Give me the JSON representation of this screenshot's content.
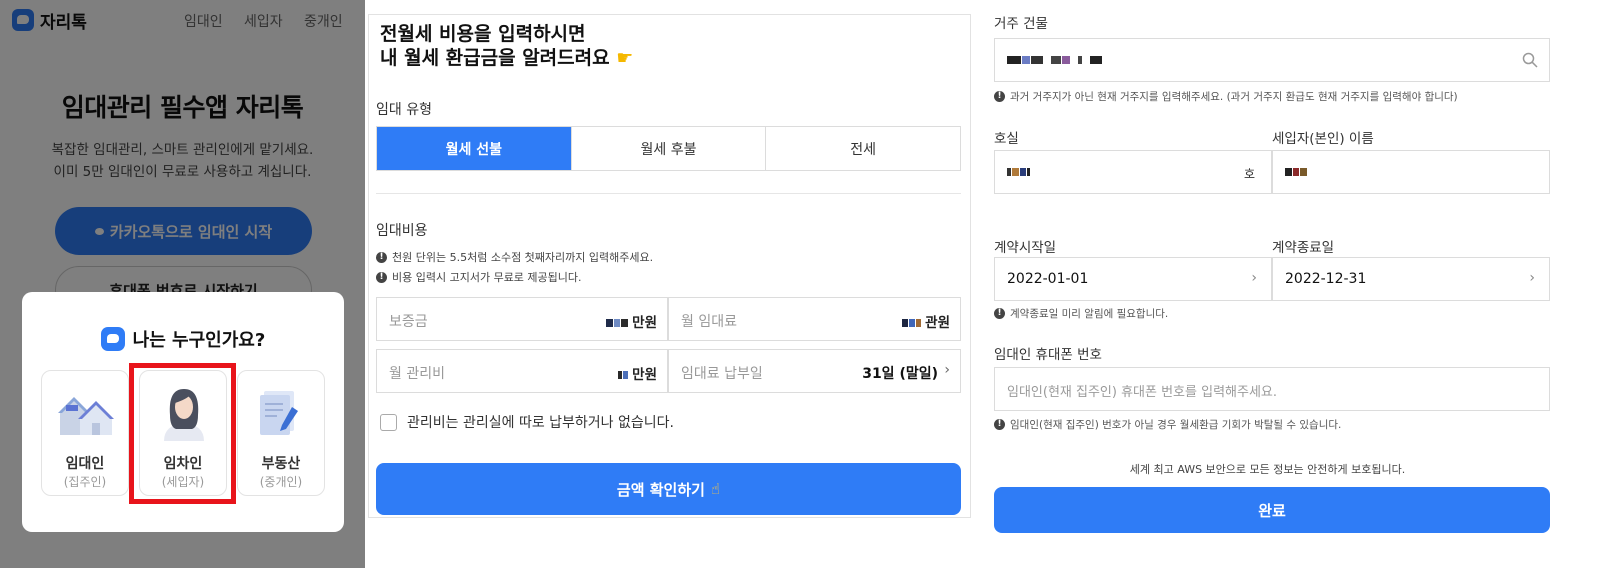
{
  "panel1": {
    "brand": "자리톡",
    "nav": [
      "임대인",
      "세입자",
      "중개인"
    ],
    "hero_title": "임대관리 필수앱 자리톡",
    "hero_sub1": "복잡한 임대관리, 스마트 관리인에게 맡기세요.",
    "hero_sub2": "이미 5만 임대인이 무료로 사용하고 계십니다.",
    "kakao_button": "카카오톡으로 임대인 시작",
    "phone_button": "휴대폰 번호로 시작하기",
    "sheet_title": "나는 누구인가요?",
    "roles": [
      {
        "name": "임대인",
        "sub": "(집주인)",
        "icon": "house-illustration"
      },
      {
        "name": "임차인",
        "sub": "(세입자)",
        "icon": "person-illustration",
        "selected": true
      },
      {
        "name": "부동산",
        "sub": "(중개인)",
        "icon": "document-pen-illustration"
      }
    ],
    "colors": {
      "accent": "#2f7cf6",
      "highlight": "#e8141b"
    }
  },
  "panel2": {
    "heading_line1": "전월세 비용을 입력하시면",
    "heading_line2": "내 월세 환급금을 알려드려요",
    "rent_type_label": "임대 유형",
    "rent_types": [
      "월세 선불",
      "월세 후불",
      "전세"
    ],
    "active_rent_type": "월세 선불",
    "cost_label": "임대비용",
    "info1": "천원 단위는 5.5처럼 소수점 첫째자리까지 입력해주세요.",
    "info2": "비용 입력시 고지서가 무료로 제공됩니다.",
    "deposit_placeholder": "보증금",
    "deposit_unit": "만원",
    "monthly_rent_placeholder": "월 임대료",
    "monthly_rent_unit": "관원",
    "management_fee_placeholder": "월 관리비",
    "management_fee_unit": "만원",
    "payday_placeholder": "임대료 납부일",
    "payday_value": "31일 (말일)",
    "checkbox_label": "관리비는 관리실에 따로 납부하거나 없습니다.",
    "cta": "금액 확인하기"
  },
  "panel3": {
    "building_label": "거주 건물",
    "building_note": "과거 거주지가 아닌 현재 거주지를 입력해주세요. (과거 거주지 환급도 현재 거주지를 입력해야 합니다)",
    "room_label": "호실",
    "room_suffix": "호",
    "tenant_label": "세입자(본인) 이름",
    "start_label": "계약시작일",
    "start_value": "2022-01-01",
    "end_label": "계약종료일",
    "end_value": "2022-12-31",
    "end_note": "계약종료일 미리 알림에 필요합니다.",
    "landlord_phone_label": "임대인 휴대폰 번호",
    "landlord_phone_placeholder": "임대인(현재 집주인) 휴대폰 번호를 입력해주세요.",
    "landlord_phone_note": "임대인(현재 집주인) 번호가 아닐 경우 월세환급 기회가 박탈될 수 있습니다.",
    "security_text": "세계 최고 AWS 보안으로 모든 정보는 안전하게 보호됩니다.",
    "done_button": "완료"
  }
}
